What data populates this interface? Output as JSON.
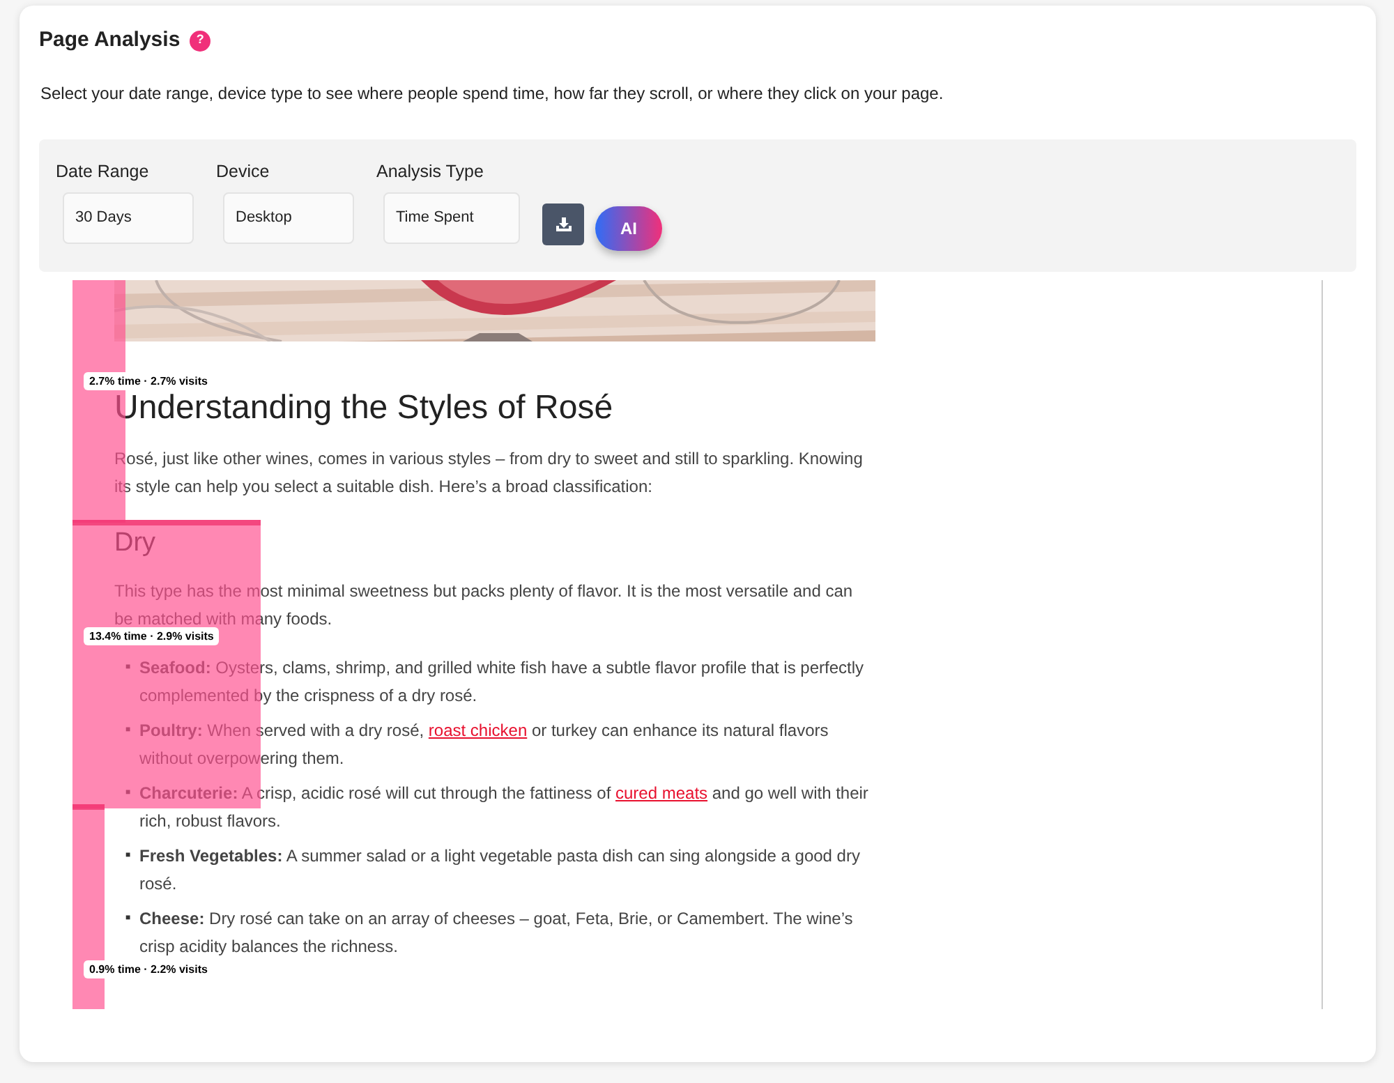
{
  "header": {
    "title": "Page Analysis",
    "help": "?",
    "description": "Select your date range, device type to see where people spend time, how far they scroll, or where they click on your page."
  },
  "filters": [
    {
      "label": "Date Range",
      "value": "30 Days"
    },
    {
      "label": "Device",
      "value": "Desktop"
    },
    {
      "label": "Analysis Type",
      "value": "Time Spent"
    }
  ],
  "ai_button": "AI",
  "preview": {
    "heading": "Understanding the Styles of Rosé",
    "intro": "Rosé, just like other wines, comes in various styles – from dry to sweet and still to sparkling. Knowing its style can help you select a suitable dish. Here’s a broad classification:",
    "subheading": "Dry",
    "paragraph": "This type has the most minimal sweetness but packs plenty of flavor. It is the most versatile and can be matched with many foods.",
    "list": [
      {
        "marker": "■",
        "term": "Seafood:",
        "text": "Oysters, clams, shrimp, and grilled white fish have a subtle flavor profile that is perfectly complemented by the crispness of a dry rosé."
      },
      {
        "marker": "■",
        "term": "Poultry:",
        "text": "When served with a dry rosé,",
        "link": "roast chicken",
        "after": "or turkey can enhance its natural flavors without overpowering them."
      },
      {
        "marker": "■",
        "term": "Charcuterie:",
        "text": "A crisp, acidic rosé will cut through the fattiness of",
        "link": "cured meats",
        "after": "and go well with their rich, robust flavors."
      },
      {
        "marker": "■",
        "term": "Fresh Vegetables:",
        "text": "A summer salad or a light vegetable pasta dish can sing alongside a good dry rosé."
      },
      {
        "marker": "■",
        "term": "Cheese:",
        "text": "Dry rosé can take on an array of cheeses – goat, Feta, Brie, or Camembert. The wine’s crisp acidity balances the richness."
      }
    ]
  },
  "heatmap": [
    {
      "label": "2.7% time · 2.7% visits",
      "level": 0.042
    },
    {
      "label": "13.4% time · 2.9% visits",
      "level": 0.15
    },
    {
      "label": "0.9% time · 2.2% visits",
      "level": 0.026
    }
  ]
}
